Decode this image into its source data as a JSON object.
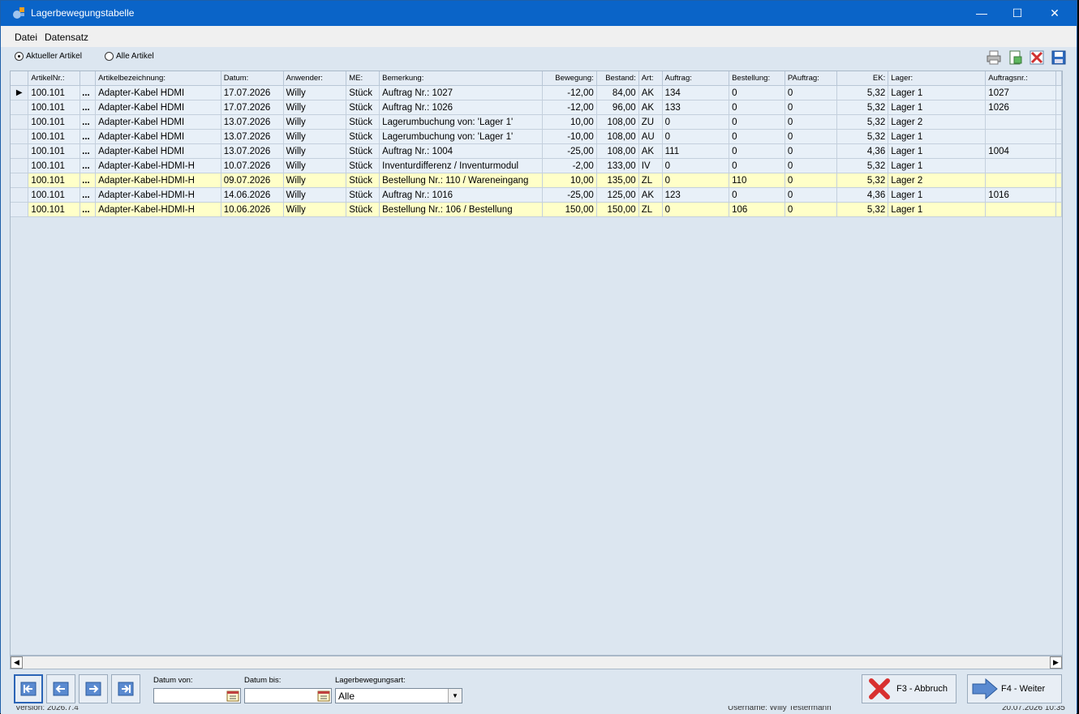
{
  "window": {
    "title": "Lagerbewegungstabelle",
    "controls": {
      "minimize": "—",
      "maximize": "☐",
      "close": "✕"
    }
  },
  "menu": {
    "items": [
      "Datei",
      "Datensatz"
    ]
  },
  "filters": {
    "radio_current": "Aktueller Artikel",
    "radio_all": "Alle Artikel",
    "selected": "current"
  },
  "toolbar_icons": [
    "printer-icon",
    "export-icon",
    "delete-icon",
    "save-icon"
  ],
  "table": {
    "columns": [
      "ArtikelNr.:",
      "",
      "Artikelbezeichnung:",
      "Datum:",
      "Anwender:",
      "ME:",
      "Bemerkung:",
      "Bewegung:",
      "Bestand:",
      "Art:",
      "Auftrag:",
      "Bestellung:",
      "PAuftrag:",
      "EK:",
      "Lager:",
      "Auftragsnr.:"
    ],
    "rows": [
      {
        "highlight": false,
        "cells": [
          "100.101",
          "...",
          "Adapter-Kabel HDMI",
          "17.07.2026",
          "Willy",
          "Stück",
          "Auftrag Nr.: 1027",
          "-12,00",
          "84,00",
          "AK",
          "134",
          "0",
          "0",
          "5,32",
          "Lager 1",
          "1027"
        ]
      },
      {
        "highlight": false,
        "cells": [
          "100.101",
          "...",
          "Adapter-Kabel HDMI",
          "17.07.2026",
          "Willy",
          "Stück",
          "Auftrag Nr.: 1026",
          "-12,00",
          "96,00",
          "AK",
          "133",
          "0",
          "0",
          "5,32",
          "Lager 1",
          "1026"
        ]
      },
      {
        "highlight": false,
        "cells": [
          "100.101",
          "...",
          "Adapter-Kabel HDMI",
          "13.07.2026",
          "Willy",
          "Stück",
          "Lagerumbuchung von: 'Lager 1'",
          "10,00",
          "108,00",
          "ZU",
          "0",
          "0",
          "0",
          "5,32",
          "Lager 2",
          ""
        ]
      },
      {
        "highlight": false,
        "cells": [
          "100.101",
          "...",
          "Adapter-Kabel HDMI",
          "13.07.2026",
          "Willy",
          "Stück",
          "Lagerumbuchung von: 'Lager 1'",
          "-10,00",
          "108,00",
          "AU",
          "0",
          "0",
          "0",
          "5,32",
          "Lager 1",
          ""
        ]
      },
      {
        "highlight": false,
        "cells": [
          "100.101",
          "...",
          "Adapter-Kabel HDMI",
          "13.07.2026",
          "Willy",
          "Stück",
          "Auftrag Nr.: 1004",
          "-25,00",
          "108,00",
          "AK",
          "111",
          "0",
          "0",
          "4,36",
          "Lager 1",
          "1004"
        ]
      },
      {
        "highlight": false,
        "cells": [
          "100.101",
          "...",
          "Adapter-Kabel-HDMI-H",
          "10.07.2026",
          "Willy",
          "Stück",
          "Inventurdifferenz / Inventurmodul",
          "-2,00",
          "133,00",
          "IV",
          "0",
          "0",
          "0",
          "5,32",
          "Lager 1",
          ""
        ]
      },
      {
        "highlight": true,
        "cells": [
          "100.101",
          "...",
          "Adapter-Kabel-HDMI-H",
          "09.07.2026",
          "Willy",
          "Stück",
          "Bestellung Nr.: 110 / Wareneingang",
          "10,00",
          "135,00",
          "ZL",
          "0",
          "110",
          "0",
          "5,32",
          "Lager 2",
          ""
        ]
      },
      {
        "highlight": false,
        "cells": [
          "100.101",
          "...",
          "Adapter-Kabel-HDMI-H",
          "14.06.2026",
          "Willy",
          "Stück",
          "Auftrag Nr.: 1016",
          "-25,00",
          "125,00",
          "AK",
          "123",
          "0",
          "0",
          "4,36",
          "Lager 1",
          "1016"
        ]
      },
      {
        "highlight": true,
        "cells": [
          "100.101",
          "...",
          "Adapter-Kabel-HDMI-H",
          "10.06.2026",
          "Willy",
          "Stück",
          "Bestellung Nr.: 106 / Bestellung",
          "150,00",
          "150,00",
          "ZL",
          "0",
          "106",
          "0",
          "5,32",
          "Lager 1",
          ""
        ]
      }
    ]
  },
  "bottom": {
    "date_from_label": "Datum von:",
    "date_from_value": "",
    "date_to_label": "Datum bis:",
    "date_to_value": "",
    "movement_type_label": "Lagerbewegungsart:",
    "movement_type_value": "Alle",
    "cancel_label": "F3 - Abbruch",
    "next_label": "F4 - Weiter"
  },
  "status": {
    "version": "Version: 2026.7.4",
    "username": "Username: Willy Testermann",
    "datetime": "20.07.2026 10:35"
  },
  "colors": {
    "titlebar": "#0a64c8",
    "highlight_row": "#ffffc8",
    "row": "#e8f0f8"
  }
}
